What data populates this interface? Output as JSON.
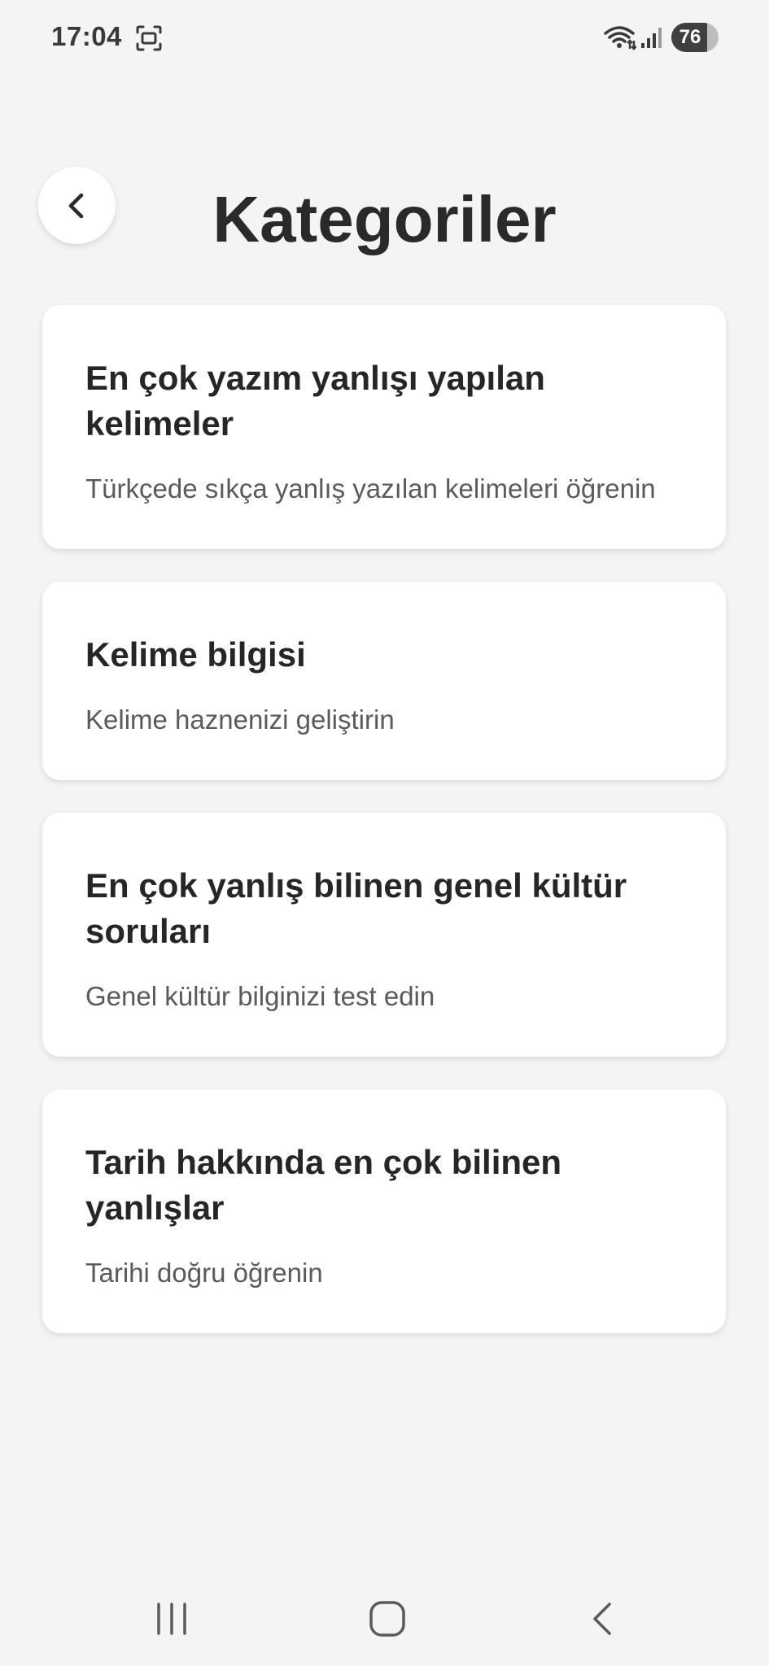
{
  "status_bar": {
    "time": "17:04",
    "battery_level": "76",
    "icons": [
      "screenshot-icon",
      "wifi-icon",
      "signal-icon",
      "battery-icon"
    ]
  },
  "header": {
    "back_icon": "chevron-left-icon",
    "title": "Kategoriler"
  },
  "categories": [
    {
      "title": "En çok yazım yanlışı yapılan kelimeler",
      "description": "Türkçede sıkça yanlış yazılan kelimeleri öğrenin"
    },
    {
      "title": "Kelime bilgisi",
      "description": "Kelime haznenizi geliştirin"
    },
    {
      "title": "En çok yanlış bilinen genel kültür soruları",
      "description": "Genel kültür bilginizi test edin"
    },
    {
      "title": "Tarih hakkında en çok bilinen yanlışlar",
      "description": "Tarihi doğru öğrenin"
    }
  ],
  "nav_bar": {
    "icons": [
      "recent-apps-icon",
      "home-icon",
      "back-icon"
    ]
  },
  "colors": {
    "background": "#f4f4f4",
    "card": "#ffffff",
    "title_text": "#2a2a2a",
    "secondary_text": "#5a5a5a"
  }
}
